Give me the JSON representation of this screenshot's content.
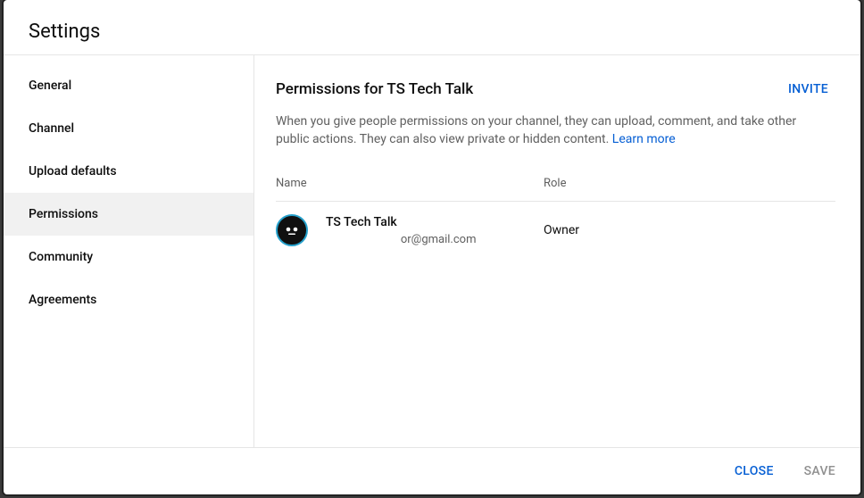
{
  "header": {
    "title": "Settings"
  },
  "sidebar": {
    "items": [
      {
        "label": "General",
        "selected": false
      },
      {
        "label": "Channel",
        "selected": false
      },
      {
        "label": "Upload defaults",
        "selected": false
      },
      {
        "label": "Permissions",
        "selected": true
      },
      {
        "label": "Community",
        "selected": false
      },
      {
        "label": "Agreements",
        "selected": false
      }
    ]
  },
  "content": {
    "title": "Permissions for TS Tech Talk",
    "invite": "INVITE",
    "description": "When you give people permissions on your channel, they can upload, comment, and take other public actions. They can also view private or hidden content. ",
    "learn_more": "Learn more",
    "table": {
      "header_name": "Name",
      "header_role": "Role",
      "rows": [
        {
          "name": "TS Tech Talk",
          "email": "                          or@gmail.com",
          "role": "Owner"
        }
      ]
    }
  },
  "footer": {
    "close": "CLOSE",
    "save": "SAVE"
  }
}
